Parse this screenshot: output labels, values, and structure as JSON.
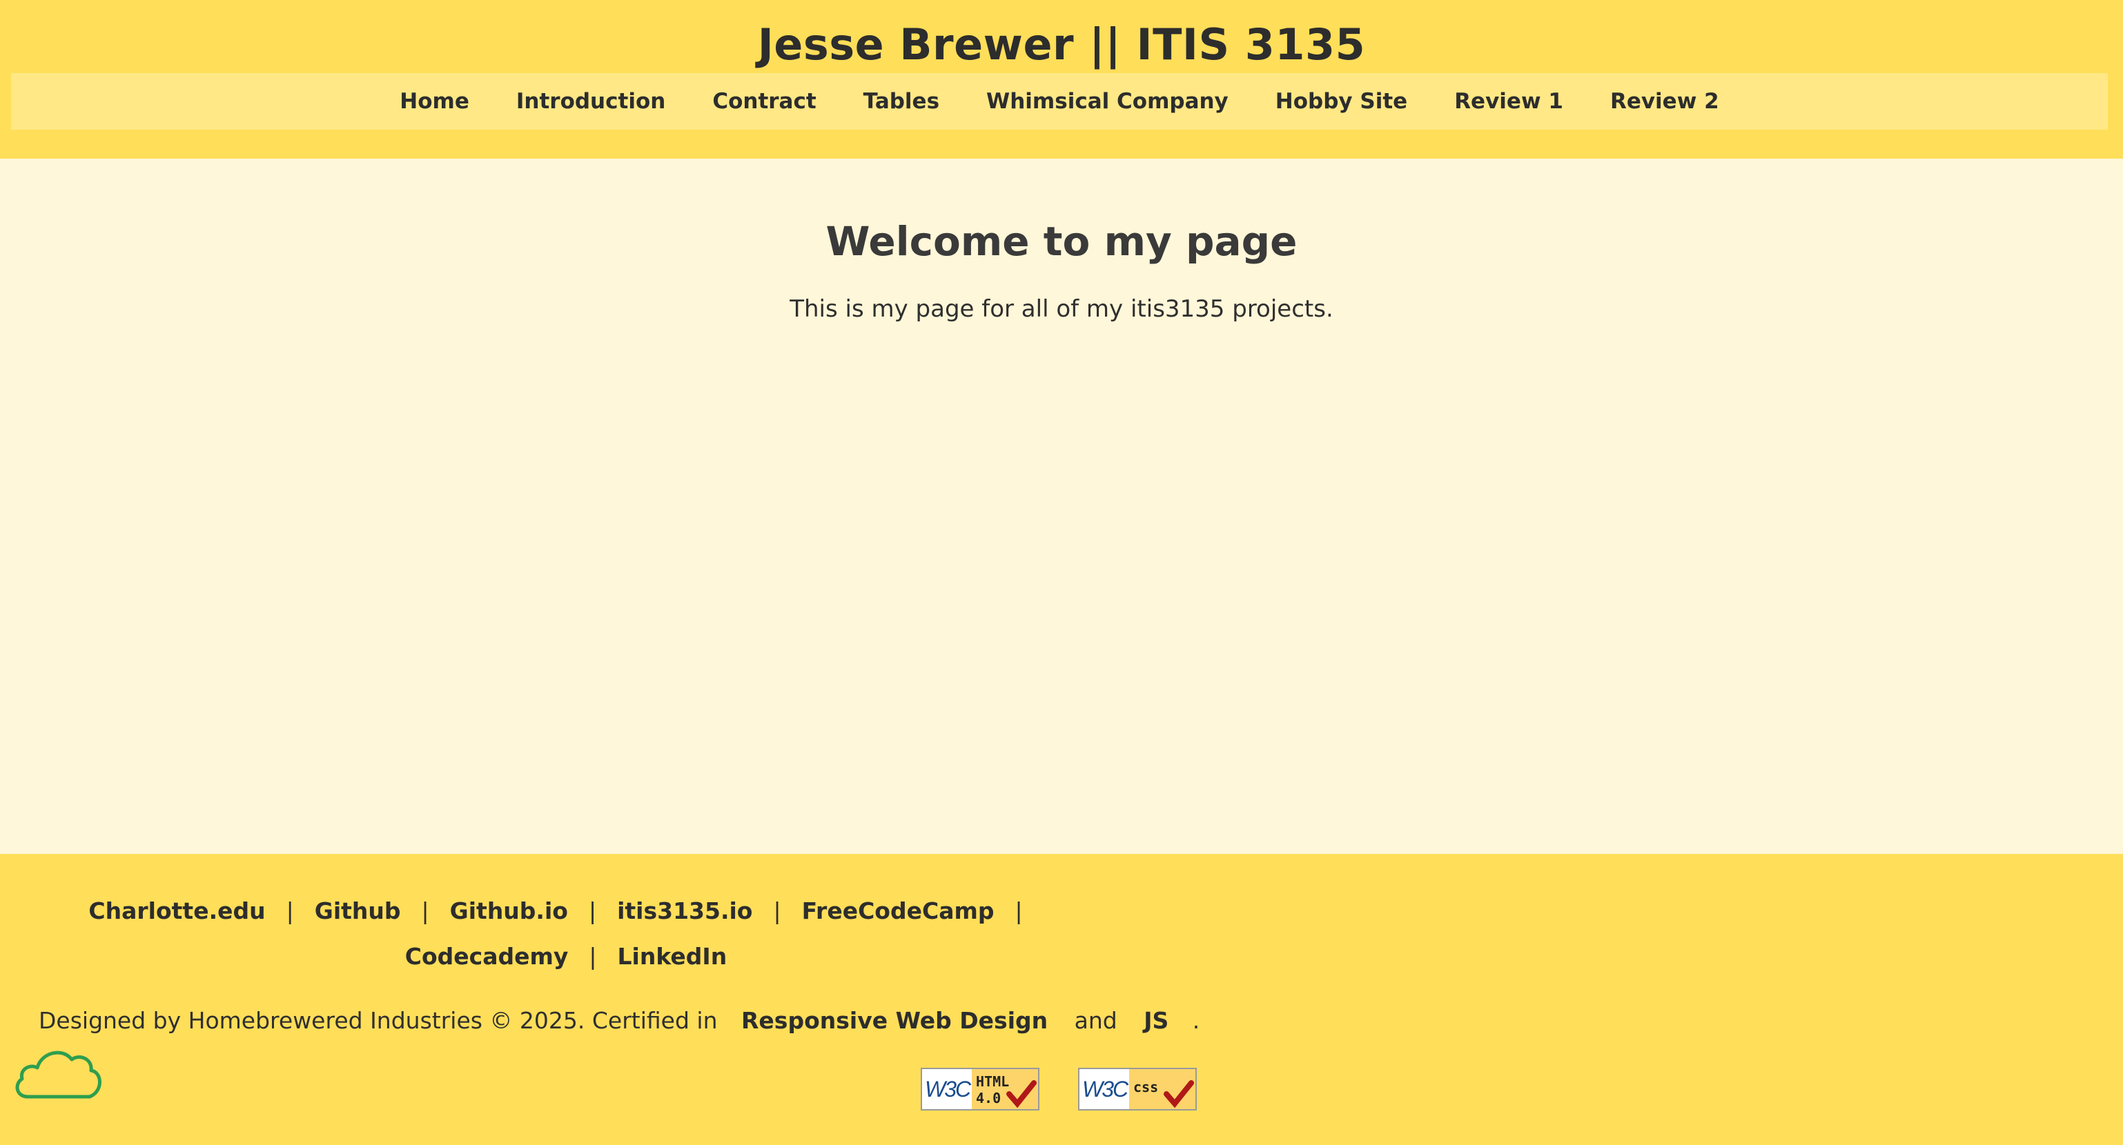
{
  "header": {
    "title": "Jesse Brewer || ITIS 3135",
    "nav": [
      "Home",
      "Introduction",
      "Contract",
      "Tables",
      "Whimsical Company",
      "Hobby Site",
      "Review 1",
      "Review 2"
    ]
  },
  "main": {
    "heading": "Welcome to my page",
    "text": "This is my page for all of my itis3135 projects."
  },
  "footer": {
    "links": [
      "Charlotte.edu",
      "Github",
      "Github.io",
      "itis3135.io",
      "FreeCodeCamp",
      "Codecademy",
      "LinkedIn"
    ],
    "separator": "|",
    "credit_prefix": "Designed by Homebrewered Industries © 2025. Certified in",
    "cert1": "Responsive Web Design",
    "and": "and",
    "cert2": "JS",
    "period": ".",
    "badges": [
      {
        "logo": "W3C",
        "label_line1": "HTML",
        "label_line2": "4.0"
      },
      {
        "logo": "W3C",
        "label_line1": "css",
        "label_line2": ""
      }
    ]
  },
  "colors": {
    "header_bg": "#ffde59",
    "nav_bg": "#ffe885",
    "main_bg": "#fff7d9",
    "cloud_stroke": "#2e9e4f"
  }
}
